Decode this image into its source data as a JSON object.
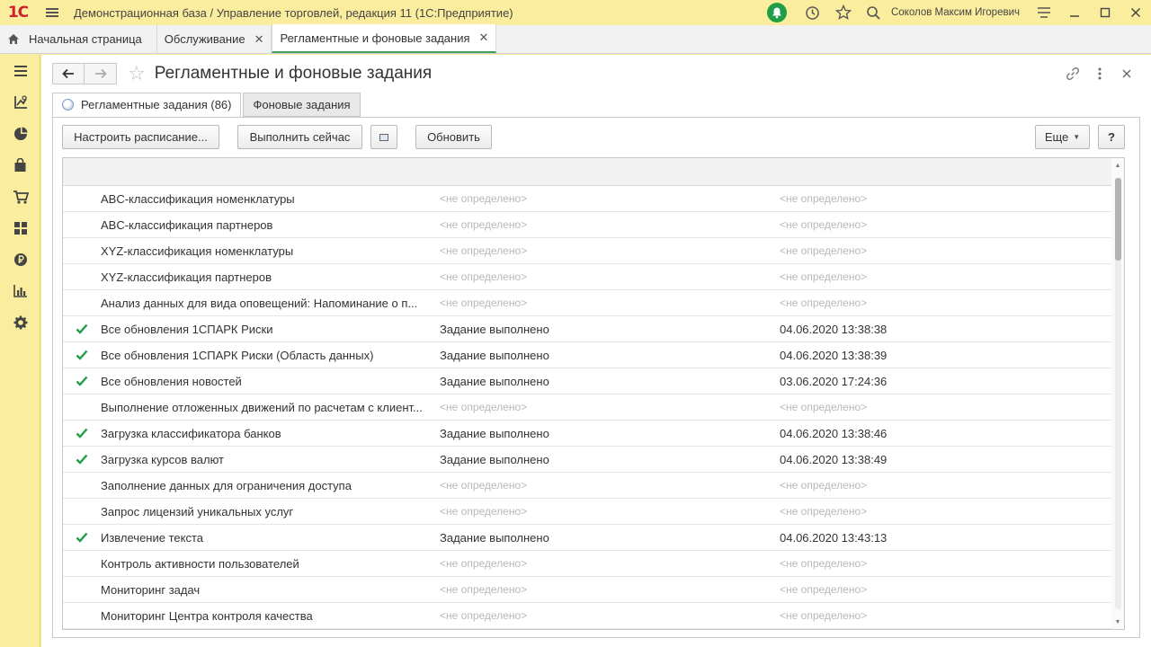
{
  "app": {
    "logo": "1С",
    "title": "Демонстрационная база / Управление торговлей, редакция 11  (1С:Предприятие)",
    "user": "Соколов Максим Игоревич"
  },
  "tabs": [
    {
      "label": "Начальная страница"
    },
    {
      "label": "Обслуживание"
    },
    {
      "label": "Регламентные и фоновые задания"
    }
  ],
  "page": {
    "title": "Регламентные и фоновые задания"
  },
  "subtabs": [
    {
      "label": "Регламентные задания (86)"
    },
    {
      "label": "Фоновые задания"
    }
  ],
  "toolbar": {
    "configure": "Настроить расписание...",
    "run_now": "Выполнить сейчас",
    "refresh": "Обновить",
    "more": "Еще",
    "help": "?"
  },
  "table": {
    "rows": [
      {
        "checked": false,
        "name": "ABC-классификация номенклатуры",
        "status": "<не определено>",
        "date": "<не определено>"
      },
      {
        "checked": false,
        "name": "ABC-классификация партнеров",
        "status": "<не определено>",
        "date": "<не определено>"
      },
      {
        "checked": false,
        "name": "XYZ-классификация номенклатуры",
        "status": "<не определено>",
        "date": "<не определено>"
      },
      {
        "checked": false,
        "name": "XYZ-классификация партнеров",
        "status": "<не определено>",
        "date": "<не определено>"
      },
      {
        "checked": false,
        "name": "Анализ данных для вида оповещений: Напоминание о п...",
        "status": "<не определено>",
        "date": "<не определено>"
      },
      {
        "checked": true,
        "name": "Все обновления 1СПАРК Риски",
        "status": "Задание выполнено",
        "date": "04.06.2020 13:38:38"
      },
      {
        "checked": true,
        "name": "Все обновления 1СПАРК Риски (Область данных)",
        "status": "Задание выполнено",
        "date": "04.06.2020 13:38:39"
      },
      {
        "checked": true,
        "name": "Все обновления новостей",
        "status": "Задание выполнено",
        "date": "03.06.2020 17:24:36"
      },
      {
        "checked": false,
        "name": "Выполнение отложенных движений по расчетам с клиент...",
        "status": "<не определено>",
        "date": "<не определено>"
      },
      {
        "checked": true,
        "name": "Загрузка классификатора банков",
        "status": "Задание выполнено",
        "date": "04.06.2020 13:38:46"
      },
      {
        "checked": true,
        "name": "Загрузка курсов валют",
        "status": "Задание выполнено",
        "date": "04.06.2020 13:38:49"
      },
      {
        "checked": false,
        "name": "Заполнение данных для ограничения доступа",
        "status": "<не определено>",
        "date": "<не определено>"
      },
      {
        "checked": false,
        "name": "Запрос лицензий уникальных услуг",
        "status": "<не определено>",
        "date": "<не определено>"
      },
      {
        "checked": true,
        "name": "Извлечение текста",
        "status": "Задание выполнено",
        "date": "04.06.2020 13:43:13"
      },
      {
        "checked": false,
        "name": "Контроль активности пользователей",
        "status": "<не определено>",
        "date": "<не определено>"
      },
      {
        "checked": false,
        "name": "Мониторинг задач",
        "status": "<не определено>",
        "date": "<не определено>"
      },
      {
        "checked": false,
        "name": "Мониторинг Центра контроля качества",
        "status": "<не определено>",
        "date": "<не определено>"
      }
    ]
  },
  "colors": {
    "accent": "#3f9e5a",
    "check": "#1e9e47",
    "topbar": "#fbed9e",
    "muted_text": "#b8b8b8"
  }
}
